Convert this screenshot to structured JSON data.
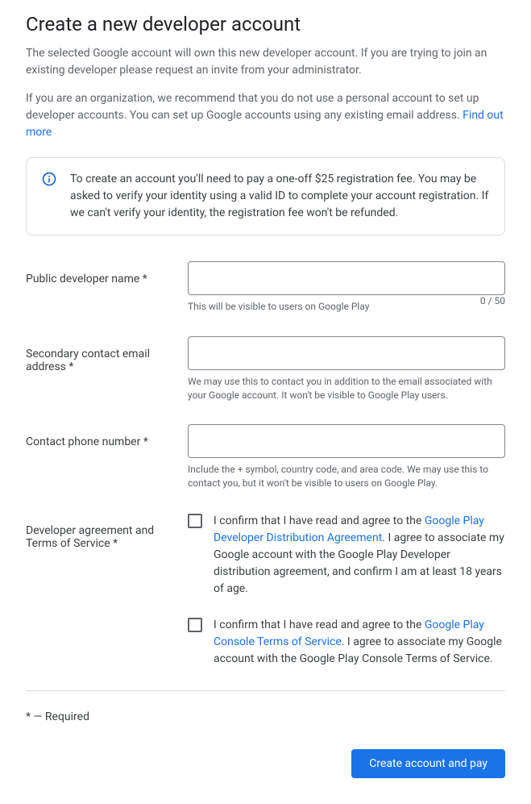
{
  "header": {
    "title": "Create a new developer account",
    "intro1": "The selected Google account will own this new developer account. If you are trying to join an existing developer please request an invite from your administrator.",
    "intro2_prefix": "If you are an organization, we recommend that you do not use a personal account to set up developer accounts. You can set up Google accounts using any existing email address. ",
    "intro2_link": "Find out more"
  },
  "info_box": {
    "text": "To create an account you'll need to pay a one-off $25 registration fee. You may be asked to verify your identity using a valid ID to complete your account registration. If we can't verify your identity, the registration fee won't be refunded."
  },
  "fields": {
    "dev_name": {
      "label": "Public developer name  *",
      "helper": "This will be visible to users on Google Play",
      "counter": "0 / 50"
    },
    "contact_email": {
      "label": "Secondary contact email address  *",
      "helper": "We may use this to contact you in addition to the email associated with your Google account. It won't be visible to Google Play users."
    },
    "phone": {
      "label": "Contact phone number  *",
      "helper": "Include the + symbol, country code, and area code. We may use this to contact you, but it won't be visible to users on Google Play."
    },
    "agreement": {
      "label": "Developer agreement and Terms of Service  *",
      "check1_prefix": "I confirm that I have read and agree to the ",
      "check1_link": "Google Play Developer Distribution Agreement",
      "check1_suffix": ". I agree to associate my Google account with the Google Play Developer distribution agreement, and confirm I am at least 18 years of age.",
      "check2_prefix": "I confirm that I have read and agree to the ",
      "check2_link": "Google Play Console Terms of Service",
      "check2_suffix": ". I agree to associate my Google account with the Google Play Console Terms of Service."
    }
  },
  "footer": {
    "required_note": "* — Required",
    "submit_label": "Create account and pay"
  }
}
